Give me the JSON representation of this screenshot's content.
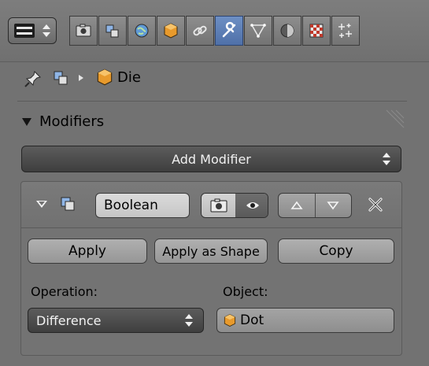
{
  "colors": {
    "background": "#727272",
    "active_tab": "#5a7cb6",
    "dark_button": "#4a4a4a",
    "object_orange": "#e89a2c"
  },
  "header": {
    "editor_type_icon": "properties-editor-icon",
    "tabs": [
      {
        "icon": "render-camera-icon",
        "active": false
      },
      {
        "icon": "render-layers-icon",
        "active": false
      },
      {
        "icon": "world-icon",
        "active": false
      },
      {
        "icon": "object-cube-icon",
        "active": false
      },
      {
        "icon": "constraints-link-icon",
        "active": false
      },
      {
        "icon": "modifiers-wrench-icon",
        "active": true
      },
      {
        "icon": "object-data-mesh-icon",
        "active": false
      },
      {
        "icon": "material-sphere-icon",
        "active": false
      },
      {
        "icon": "texture-checker-icon",
        "active": false
      },
      {
        "icon": "particles-icon",
        "active": false
      }
    ]
  },
  "breadcrumb": {
    "pin_icon": "pin-icon",
    "scene_icon": "render-layers-icon",
    "separator_icon": "chevron-right-icon",
    "object_icon": "object-cube-icon",
    "object_name": "Die"
  },
  "modifiers_panel": {
    "heading": "Modifiers",
    "add_modifier_label": "Add Modifier",
    "modifier": {
      "type_icon": "boolean-icon",
      "name": "Boolean",
      "render_enabled": true,
      "viewport_enabled": false,
      "buttons": {
        "apply": "Apply",
        "apply_as_shape": "Apply as Shape",
        "copy": "Copy"
      },
      "operation_label": "Operation:",
      "operation_value": "Difference",
      "object_label": "Object:",
      "object_value": "Dot"
    }
  }
}
